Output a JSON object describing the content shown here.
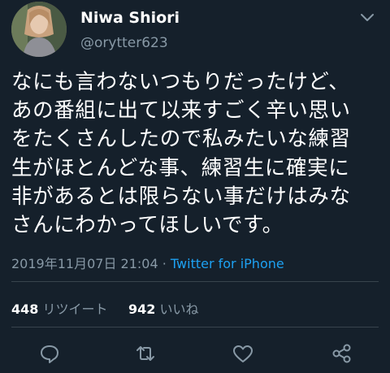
{
  "user": {
    "display_name": "Niwa Shiori",
    "handle": "@orytter623"
  },
  "tweet": {
    "lines": [
      "なにも言わないつもりだったけど、",
      "あの番組に出て以来すごく辛い思い",
      "をたくさんしたので私みたいな練習",
      "生がほとんどな事、練習生に確実に",
      "非があるとは限らない事だけはみな",
      "さんにわかってほしいです。"
    ],
    "timestamp": "2019年11月07日 21:04",
    "separator": " · ",
    "source": "Twitter for iPhone"
  },
  "stats": {
    "retweets_count": "448",
    "retweets_label": "リツイート",
    "likes_count": "942",
    "likes_label": "いいね"
  },
  "icons": {
    "header_menu": "chevron-down-icon",
    "reply": "reply-icon",
    "retweet": "retweet-icon",
    "like": "heart-icon",
    "share": "share-icon"
  },
  "colors": {
    "background": "#15202b",
    "text": "#ffffff",
    "muted": "#8899a6",
    "link": "#1da1f2",
    "divider": "#38444d"
  }
}
